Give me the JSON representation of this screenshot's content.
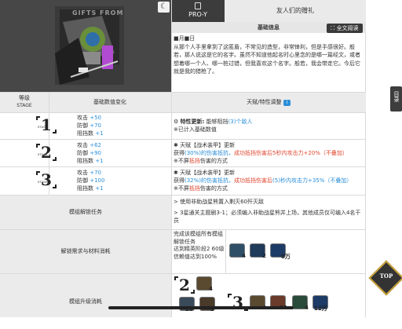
{
  "header": {
    "night_mode_icon": "moon-icon",
    "tab_label": "PRO-Y",
    "title": "友人们的赠礼",
    "basic_info_label": "基础信息",
    "full_text_button": "全文阅读",
    "art_caption": "GIFTS FROM"
  },
  "story": {
    "date_line": "■月■日",
    "body": "从那个人手里拿到了这匿盾，不常见的造型，非常锋利，但是手感很好。般若，那人说这是它的名字。虽然不知道他起名时心里念的是哪一篇经文，或者想着哪一个人、哪一桩过错，但我喜欢这个名字。般若，我会带走它。今后它就是我的猎枪了。"
  },
  "table": {
    "stage_header": "等级",
    "stage_header_en": "STAGE",
    "stat_header": "基础数值变化",
    "trait_header": "天赋/特性调整",
    "info_icon": "info-icon",
    "stage_word": "STAGE",
    "stages": [
      {
        "num": "1",
        "stats": [
          [
            "攻击",
            "+50"
          ],
          [
            "防御",
            "+70"
          ],
          [
            "阻挡数",
            "+1"
          ]
        ],
        "trait_title": "特性更新:",
        "trait_a": "能够阻挡",
        "trait_b": "(3)个敌人",
        "note": "※已计入基础数值"
      },
      {
        "num": "2",
        "stats": [
          [
            "攻击",
            "+62"
          ],
          [
            "防御",
            "+90"
          ],
          [
            "阻挡数",
            "+1"
          ]
        ],
        "trait_title": "天赋【战术装甲】更新",
        "line1_a": "获得",
        "line1_b": "(30%)的伤害抵抗，",
        "line1_c": "成功抵挡伤害后5秒内攻击力+20%（不叠加）",
        "note_a": "※不屏",
        "note_b": "抵挡",
        "note_c": "伤害的方式"
      },
      {
        "num": "3",
        "stats": [
          [
            "攻击",
            "+70"
          ],
          [
            "防御",
            "+100"
          ],
          [
            "阻挡数",
            "+1"
          ]
        ],
        "trait_title": "天赋【战术装甲】更新",
        "line1_a": "获得",
        "line1_b": "(32%)的伤害抵抗，",
        "line1_c": "成功抵挡伤害后",
        "line1_d": "(5)秒内攻击力",
        "line1_e": "+35%（不叠加）",
        "note_a": "※不屏",
        "note_b": "抵挡",
        "note_c": "伤害的方式"
      }
    ],
    "unlock_label": "模组解锁任务",
    "unlock_task1": "> 使用非助战星熊置入剿灭60歼灭敌",
    "unlock_task2": "> 3星通关主题剧3-1；必须编入非助战星熊并上场，其他成员仅可编入4名干员",
    "req_label": "解锁需求与材料消耗",
    "req_text": "完成该模组所有模组解锁任务\n达到精英阶段2 60级\n信赖值达到100%",
    "req_items": [
      [
        "mod-data-item",
        "4"
      ],
      [
        "chip-item",
        "2"
      ],
      [
        "lmd-item",
        "8万"
      ]
    ],
    "upgrade_label": "模组升级消耗",
    "upgrade_stage2_items": [
      [
        "mod-data-item",
        "4"
      ],
      [
        "item-a",
        "20"
      ],
      [
        "item-b",
        "3"
      ]
    ],
    "upgrade_stage3_items": [
      [
        "mod-data-item",
        "4"
      ],
      [
        "item-c",
        "20"
      ],
      [
        "item-d",
        "4"
      ],
      [
        "lmd-item",
        "12万"
      ]
    ]
  },
  "sidebar": {
    "right_tab": "目录"
  },
  "top_button": "TOP"
}
